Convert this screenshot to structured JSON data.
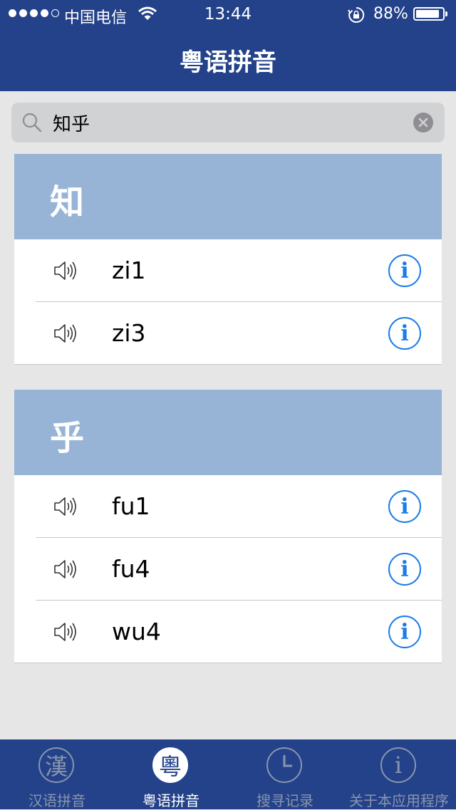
{
  "status_bar": {
    "carrier": "中国电信",
    "time": "13:44",
    "battery": "88%",
    "battery_level": 0.88
  },
  "nav": {
    "title": "粤语拼音"
  },
  "search": {
    "value": "知乎",
    "icon": "search-icon",
    "clear_icon": "clear-icon"
  },
  "sections": [
    {
      "character": "知",
      "rows": [
        {
          "pinyin": "zi1"
        },
        {
          "pinyin": "zi3"
        }
      ]
    },
    {
      "character": "乎",
      "rows": [
        {
          "pinyin": "fu1"
        },
        {
          "pinyin": "fu4"
        },
        {
          "pinyin": "wu4"
        }
      ]
    }
  ],
  "row_icons": {
    "speaker": "speaker-icon",
    "info": "info-icon",
    "info_glyph": "i"
  },
  "tabs": [
    {
      "label": "汉语拼音",
      "glyph": "漢",
      "active": false
    },
    {
      "label": "粤语拼音",
      "glyph": "粵",
      "active": true
    },
    {
      "label": "搜寻记录",
      "glyph": "",
      "active": false
    },
    {
      "label": "关于本应用程序",
      "glyph": "i",
      "active": false
    }
  ],
  "colors": {
    "nav_bg": "#23428a",
    "section_header_bg": "#97b4d6",
    "accent": "#1a7ce8",
    "page_bg": "#e6e6e6"
  }
}
